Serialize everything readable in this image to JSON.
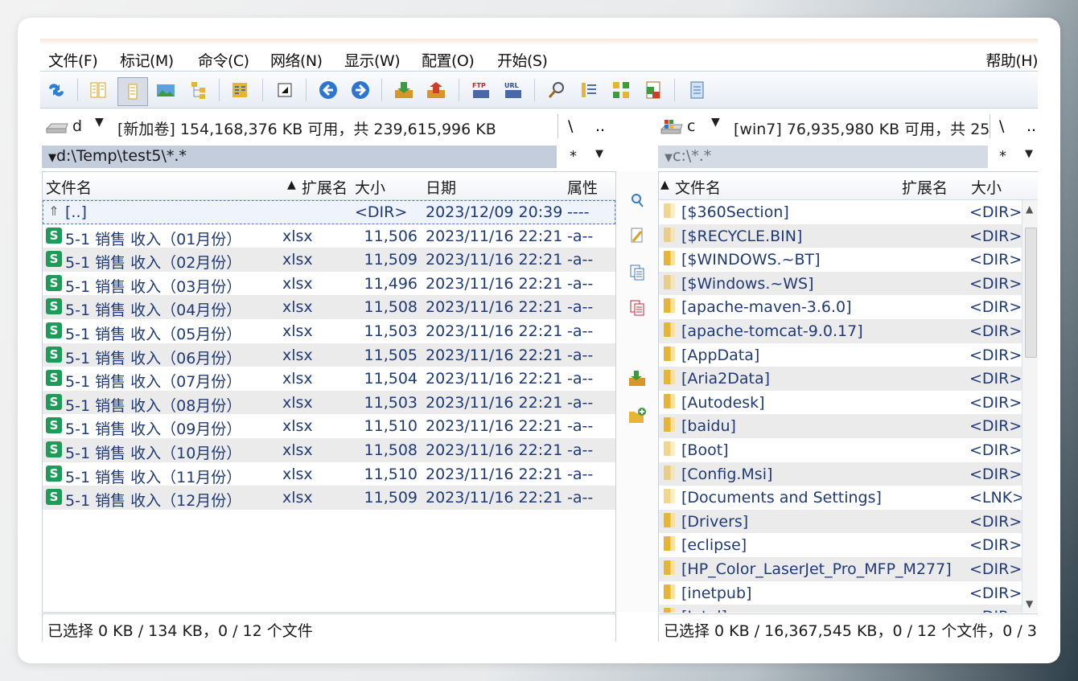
{
  "menu": {
    "items": [
      "文件(F)",
      "标记(M)",
      "命令(C)",
      "网络(N)",
      "显示(W)",
      "配置(O)",
      "开始(S)"
    ],
    "help": "帮助(H)"
  },
  "toolbar": {
    "icons": [
      "refresh-icon",
      "brief-view-icon",
      "full-view-icon",
      "thumbnail-view-icon",
      "tree-view-icon",
      "compare-icon",
      "invert-selection-icon",
      "back-icon",
      "forward-icon",
      "pack-icon",
      "unpack-icon",
      "ftp-connect-icon",
      "url-connect-icon",
      "search-icon",
      "multi-rename-icon",
      "sync-dirs-icon",
      "view-mode-icon",
      "notepad-icon"
    ]
  },
  "left": {
    "drive_letter": "d",
    "drive_info": "[新加卷]  154,168,376 KB 可用，共 239,615,996 KB",
    "root_btn": "\\",
    "parent_btn": "..",
    "path": "d:\\Temp\\test5\\*.*",
    "filter": "*",
    "columns": {
      "name": "文件名",
      "ext": "扩展名",
      "size": "大小",
      "date": "日期",
      "attr": "属性"
    },
    "parent_row": {
      "name": "[..]",
      "size": "<DIR>",
      "date": "2023/12/09 20:39",
      "attr": "----"
    },
    "files": [
      {
        "name": "5-1  销售 收入（01月份）",
        "ext": "xlsx",
        "size": "11,506",
        "date": "2023/11/16 22:21",
        "attr": "-a--"
      },
      {
        "name": "5-1  销售 收入（02月份）",
        "ext": "xlsx",
        "size": "11,509",
        "date": "2023/11/16 22:21",
        "attr": "-a--"
      },
      {
        "name": "5-1  销售 收入（03月份）",
        "ext": "xlsx",
        "size": "11,496",
        "date": "2023/11/16 22:21",
        "attr": "-a--"
      },
      {
        "name": "5-1  销售 收入（04月份）",
        "ext": "xlsx",
        "size": "11,508",
        "date": "2023/11/16 22:21",
        "attr": "-a--"
      },
      {
        "name": "5-1  销售 收入（05月份）",
        "ext": "xlsx",
        "size": "11,503",
        "date": "2023/11/16 22:21",
        "attr": "-a--"
      },
      {
        "name": "5-1  销售 收入（06月份）",
        "ext": "xlsx",
        "size": "11,505",
        "date": "2023/11/16 22:21",
        "attr": "-a--"
      },
      {
        "name": "5-1  销售 收入（07月份）",
        "ext": "xlsx",
        "size": "11,504",
        "date": "2023/11/16 22:21",
        "attr": "-a--"
      },
      {
        "name": "5-1  销售 收入（08月份）",
        "ext": "xlsx",
        "size": "11,503",
        "date": "2023/11/16 22:21",
        "attr": "-a--"
      },
      {
        "name": "5-1  销售 收入（09月份）",
        "ext": "xlsx",
        "size": "11,510",
        "date": "2023/11/16 22:21",
        "attr": "-a--"
      },
      {
        "name": "5-1  销售 收入（10月份）",
        "ext": "xlsx",
        "size": "11,508",
        "date": "2023/11/16 22:21",
        "attr": "-a--"
      },
      {
        "name": "5-1  销售 收入（11月份）",
        "ext": "xlsx",
        "size": "11,510",
        "date": "2023/11/16 22:21",
        "attr": "-a--"
      },
      {
        "name": "5-1  销售 收入（12月份）",
        "ext": "xlsx",
        "size": "11,509",
        "date": "2023/11/16 22:21",
        "attr": "-a--"
      }
    ],
    "status": "已选择 0 KB / 134 KB，0 / 12 个文件"
  },
  "right": {
    "drive_letter": "c",
    "drive_info": "[win7]  76,935,980 KB 可用，共 25",
    "root_btn": "\\",
    "parent_btn": "..",
    "path": "c:\\*.*",
    "filter": "*",
    "columns": {
      "name": "文件名",
      "ext": "扩展名",
      "size": "大小"
    },
    "files": [
      {
        "name": "[$360Section]",
        "size": "<DIR>",
        "hidden": true
      },
      {
        "name": "[$RECYCLE.BIN]",
        "size": "<DIR>",
        "hidden": true
      },
      {
        "name": "[$WINDOWS.~BT]",
        "size": "<DIR>",
        "hidden": false
      },
      {
        "name": "[$Windows.~WS]",
        "size": "<DIR>",
        "hidden": true
      },
      {
        "name": "[apache-maven-3.6.0]",
        "size": "<DIR>",
        "hidden": false
      },
      {
        "name": "[apache-tomcat-9.0.17]",
        "size": "<DIR>",
        "hidden": false
      },
      {
        "name": "[AppData]",
        "size": "<DIR>",
        "hidden": false
      },
      {
        "name": "[Aria2Data]",
        "size": "<DIR>",
        "hidden": false
      },
      {
        "name": "[Autodesk]",
        "size": "<DIR>",
        "hidden": false
      },
      {
        "name": "[baidu]",
        "size": "<DIR>",
        "hidden": false
      },
      {
        "name": "[Boot]",
        "size": "<DIR>",
        "hidden": true
      },
      {
        "name": "[Config.Msi]",
        "size": "<DIR>",
        "hidden": true
      },
      {
        "name": "[Documents and Settings]",
        "size": "<LNK>",
        "hidden": true
      },
      {
        "name": "[Drivers]",
        "size": "<DIR>",
        "hidden": false
      },
      {
        "name": "[eclipse]",
        "size": "<DIR>",
        "hidden": false
      },
      {
        "name": "[HP_Color_LaserJet_Pro_MFP_M277]",
        "size": "<DIR>",
        "hidden": false
      },
      {
        "name": "[inetpub]",
        "size": "<DIR>",
        "hidden": false
      },
      {
        "name": "[Intel]",
        "size": "<DIR>",
        "hidden": false
      }
    ],
    "status": "已选择 0 KB / 16,367,545 KB，0 / 12 个文件，0 / 3"
  },
  "middle_buttons": [
    "view-file-icon",
    "edit-file-icon",
    "copy-file-icon",
    "move-file-icon",
    "pack-files-icon",
    "new-folder-icon"
  ],
  "colors": {
    "accent": "#1f3a78",
    "path_active": "#c3cddb",
    "xls_green": "#1e9b58",
    "folder": "#e7b536"
  }
}
